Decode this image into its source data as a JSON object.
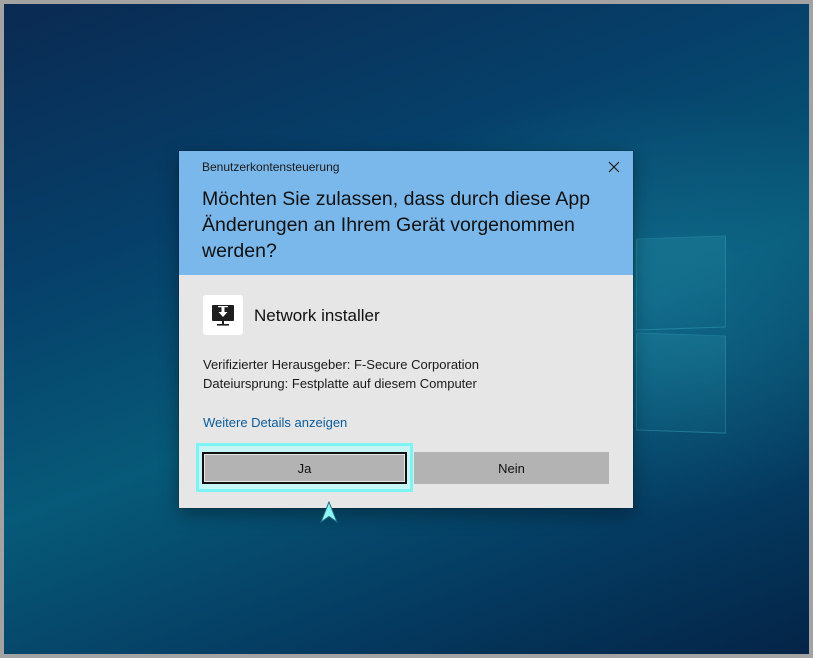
{
  "dialog": {
    "title": "Benutzerkontensteuerung",
    "close_icon": "close-icon",
    "question": "Möchten Sie zulassen, dass durch diese App Änderungen an Ihrem Gerät vorgenommen werden?",
    "app_icon": "network-installer-icon",
    "app_name": "Network installer",
    "publisher": "Verifizierter Herausgeber: F-Secure Corporation",
    "origin": "Dateiursprung: Festplatte auf diesem Computer",
    "details_link": "Weitere Details anzeigen",
    "yes_label": "Ja",
    "no_label": "Nein"
  },
  "colors": {
    "header": "#7ab7ea",
    "body": "#e6e6e6",
    "button": "#b3b3b3",
    "focus_ring": "#7ef3f3",
    "link": "#0a5c9c"
  },
  "cursor_icon": "pointer-arrow-icon"
}
